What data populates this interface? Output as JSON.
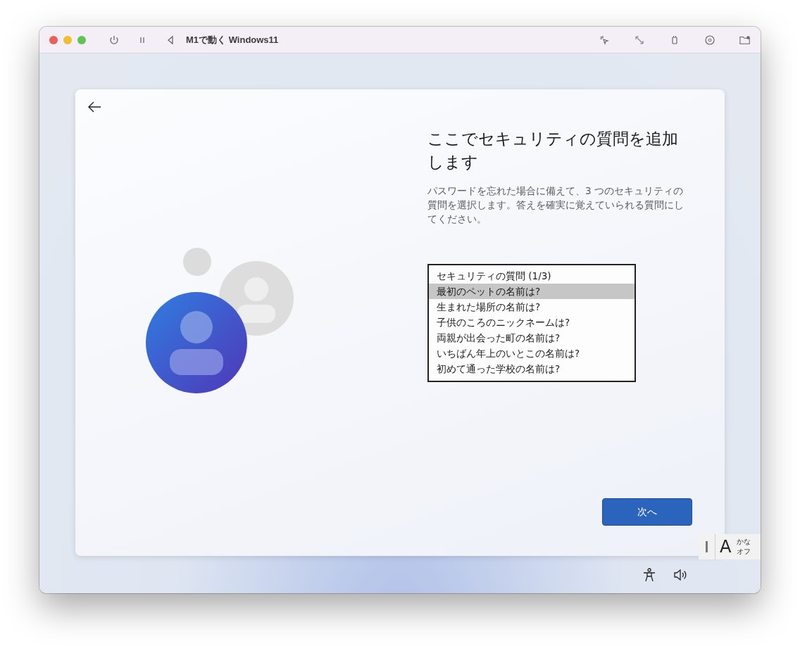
{
  "window": {
    "title": "M1で動く Windows11"
  },
  "setup": {
    "heading": "ここでセキュリティの質問を追加します",
    "description": "パスワードを忘れた場合に備えて、3 つのセキュリティの質問を選択します。答えを確実に覚えていられる質問にしてください。",
    "dropdown": {
      "options": [
        {
          "label": "セキュリティの質問 (1/3)",
          "selected": false
        },
        {
          "label": "最初のペットの名前は?",
          "selected": true
        },
        {
          "label": "生まれた場所の名前は?",
          "selected": false
        },
        {
          "label": "子供のころのニックネームは?",
          "selected": false
        },
        {
          "label": "両親が出会った町の名前は?",
          "selected": false
        },
        {
          "label": "いちばん年上のいとこの名前は?",
          "selected": false
        },
        {
          "label": "初めて通った学校の名前は?",
          "selected": false
        }
      ]
    },
    "next_button": "次へ"
  },
  "ime_bar": {
    "mode": "A",
    "kana_line_1": "かな",
    "kana_line_2": "オフ"
  }
}
